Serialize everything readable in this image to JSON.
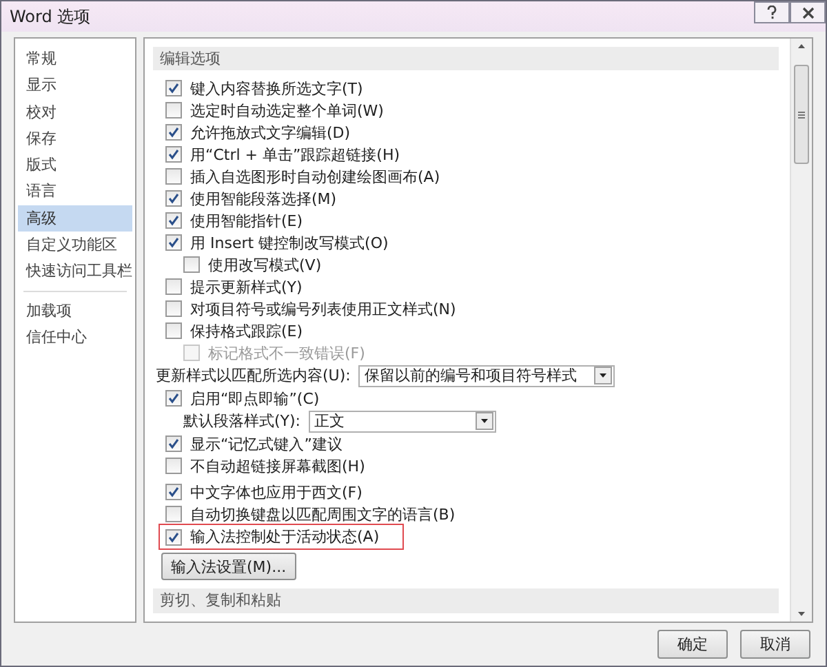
{
  "window": {
    "title": "Word 选项"
  },
  "sidebar": {
    "groups": [
      {
        "items": [
          {
            "label": "常规",
            "selected": false
          },
          {
            "label": "显示",
            "selected": false
          },
          {
            "label": "校对",
            "selected": false
          },
          {
            "label": "保存",
            "selected": false
          },
          {
            "label": "版式",
            "selected": false
          },
          {
            "label": "语言",
            "selected": false
          },
          {
            "label": "高级",
            "selected": true
          },
          {
            "label": "自定义功能区",
            "selected": false
          },
          {
            "label": "快速访问工具栏",
            "selected": false
          }
        ]
      },
      {
        "items": [
          {
            "label": "加载项",
            "selected": false
          },
          {
            "label": "信任中心",
            "selected": false
          }
        ]
      }
    ]
  },
  "section": {
    "title": "编辑选项"
  },
  "option_groups": [
    [
      {
        "kind": "checkbox",
        "label": "键入内容替换所选文字(T)",
        "checked": true,
        "disabled": false,
        "highlighted": false
      },
      {
        "kind": "checkbox",
        "label": "选定时自动选定整个单词(W)",
        "checked": false,
        "disabled": false,
        "highlighted": false
      },
      {
        "kind": "checkbox",
        "label": "允许拖放式文字编辑(D)",
        "checked": true,
        "disabled": false,
        "highlighted": false
      },
      {
        "kind": "checkbox",
        "label": "用“Ctrl + 单击”跟踪超链接(H)",
        "checked": true,
        "disabled": false,
        "highlighted": false
      },
      {
        "kind": "checkbox",
        "label": "插入自选图形时自动创建绘图画布(A)",
        "checked": false,
        "disabled": false,
        "highlighted": false
      },
      {
        "kind": "checkbox",
        "label": "使用智能段落选择(M)",
        "checked": true,
        "disabled": false,
        "highlighted": false
      },
      {
        "kind": "checkbox",
        "label": "使用智能指针(E)",
        "checked": true,
        "disabled": false,
        "highlighted": false
      },
      {
        "kind": "checkbox",
        "label": "用 Insert 键控制改写模式(O)",
        "checked": true,
        "disabled": false,
        "highlighted": false,
        "children": [
          {
            "kind": "checkbox",
            "label": "使用改写模式(V)",
            "checked": false,
            "disabled": false,
            "highlighted": false
          }
        ]
      },
      {
        "kind": "checkbox",
        "label": "提示更新样式(Y)",
        "checked": false,
        "disabled": false,
        "highlighted": false
      },
      {
        "kind": "checkbox",
        "label": "对项目符号或编号列表使用正文样式(N)",
        "checked": false,
        "disabled": false,
        "highlighted": false
      },
      {
        "kind": "checkbox",
        "label": "保持格式跟踪(E)",
        "checked": false,
        "disabled": false,
        "highlighted": false,
        "children": [
          {
            "kind": "checkbox",
            "label": "标记格式不一致错误(F)",
            "checked": false,
            "disabled": true,
            "highlighted": false
          }
        ]
      },
      {
        "kind": "select",
        "label": "更新样式以匹配所选内容(U):",
        "value": "保留以前的编号和项目符号样式"
      },
      {
        "kind": "checkbox",
        "label": "启用“即点即输”(C)",
        "checked": true,
        "disabled": false,
        "highlighted": false,
        "children": [
          {
            "kind": "select",
            "label": "默认段落样式(Y):",
            "value": "正文"
          }
        ]
      },
      {
        "kind": "checkbox",
        "label": "显示“记忆式键入”建议",
        "checked": true,
        "disabled": false,
        "highlighted": false
      },
      {
        "kind": "checkbox",
        "label": "不自动超链接屏幕截图(H)",
        "checked": false,
        "disabled": false,
        "highlighted": false
      }
    ],
    [
      {
        "kind": "checkbox",
        "label": "中文字体也应用于西文(F)",
        "checked": true,
        "disabled": false,
        "highlighted": false
      },
      {
        "kind": "checkbox",
        "label": "自动切换键盘以匹配周围文字的语言(B)",
        "checked": false,
        "disabled": false,
        "highlighted": false
      },
      {
        "kind": "checkbox",
        "label": "输入法控制处于活动状态(A)",
        "checked": true,
        "disabled": false,
        "highlighted": true
      },
      {
        "kind": "button",
        "label": "输入法设置(M)..."
      }
    ]
  ],
  "next_section": {
    "title": "剪切、复制和粘贴"
  },
  "buttons": [
    {
      "label": "确定"
    },
    {
      "label": "取消"
    }
  ]
}
